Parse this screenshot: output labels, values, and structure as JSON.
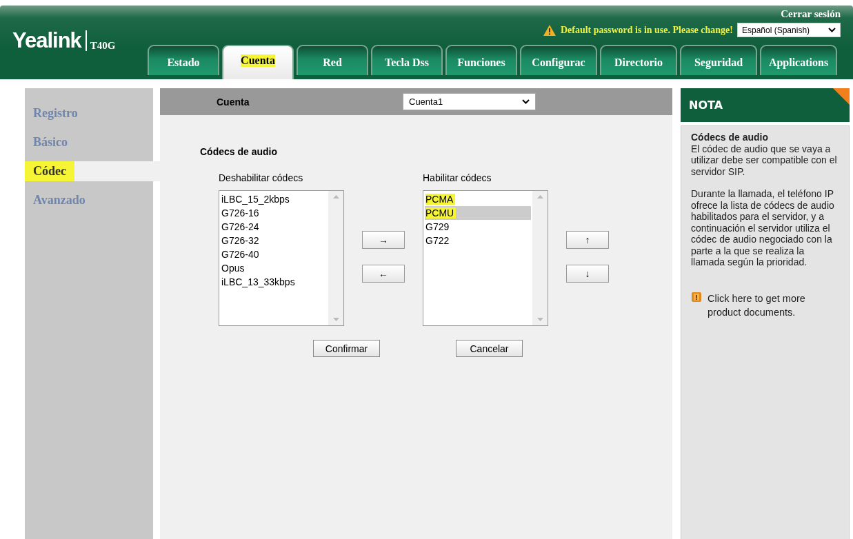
{
  "header": {
    "logo": "Yealink",
    "model": "T40G",
    "logout": "Cerrar sesión",
    "warning": "Default password is in use. Please change!",
    "language": "Español (Spanish)"
  },
  "tabs": [
    {
      "label": "Estado",
      "selected": false,
      "highlighted": false
    },
    {
      "label": "Cuenta",
      "selected": true,
      "highlighted": true
    },
    {
      "label": "Red",
      "selected": false,
      "highlighted": false
    },
    {
      "label": "Tecla Dss",
      "selected": false,
      "highlighted": false
    },
    {
      "label": "Funciones",
      "selected": false,
      "highlighted": false
    },
    {
      "label": "Configurac",
      "selected": false,
      "highlighted": false
    },
    {
      "label": "Directorio",
      "selected": false,
      "highlighted": false
    },
    {
      "label": "Seguridad",
      "selected": false,
      "highlighted": false
    },
    {
      "label": "Applications",
      "selected": false,
      "highlighted": false
    }
  ],
  "sidebar": {
    "items": [
      {
        "label": "Registro",
        "selected": false,
        "highlighted": false
      },
      {
        "label": "Básico",
        "selected": false,
        "highlighted": false
      },
      {
        "label": "Códec",
        "selected": true,
        "highlighted": true
      },
      {
        "label": "Avanzado",
        "selected": false,
        "highlighted": false
      }
    ]
  },
  "account_bar": {
    "label": "Cuenta",
    "value": "Cuenta1"
  },
  "section_title": "Códecs de audio",
  "disabled_list": {
    "label": "Deshabilitar códecs",
    "items": [
      {
        "label": "iLBC_15_2kbps",
        "selected": false,
        "highlighted": false
      },
      {
        "label": "G726-16",
        "selected": false,
        "highlighted": false
      },
      {
        "label": "G726-24",
        "selected": false,
        "highlighted": false
      },
      {
        "label": "G726-32",
        "selected": false,
        "highlighted": false
      },
      {
        "label": "G726-40",
        "selected": false,
        "highlighted": false
      },
      {
        "label": "Opus",
        "selected": false,
        "highlighted": false
      },
      {
        "label": "iLBC_13_33kbps",
        "selected": false,
        "highlighted": false
      }
    ]
  },
  "move_buttons": [
    "→",
    "←"
  ],
  "enabled_list": {
    "label": "Habilitar códecs",
    "items": [
      {
        "label": "PCMA",
        "selected": false,
        "highlighted": true
      },
      {
        "label": "PCMU",
        "selected": true,
        "highlighted": true
      },
      {
        "label": "G729",
        "selected": false,
        "highlighted": false
      },
      {
        "label": "G722",
        "selected": false,
        "highlighted": false
      }
    ]
  },
  "order_buttons": [
    "↑",
    "↓"
  ],
  "buttons": [
    "Confirmar",
    "Cancelar"
  ],
  "note": {
    "title": "NOTA",
    "heading": "Códecs de audio",
    "paragraphs": [
      "El códec de audio que se vaya a utilizar debe ser compatible con el servidor SIP.",
      "Durante la llamada, el teléfono IP ofrece la lista de códecs de audio habilitados para el servidor, y a continuación el servidor utiliza el códec de audio negociado con la parte a la que se realiza la llamada según la prioridad."
    ],
    "link": "Click here to get more product documents."
  }
}
